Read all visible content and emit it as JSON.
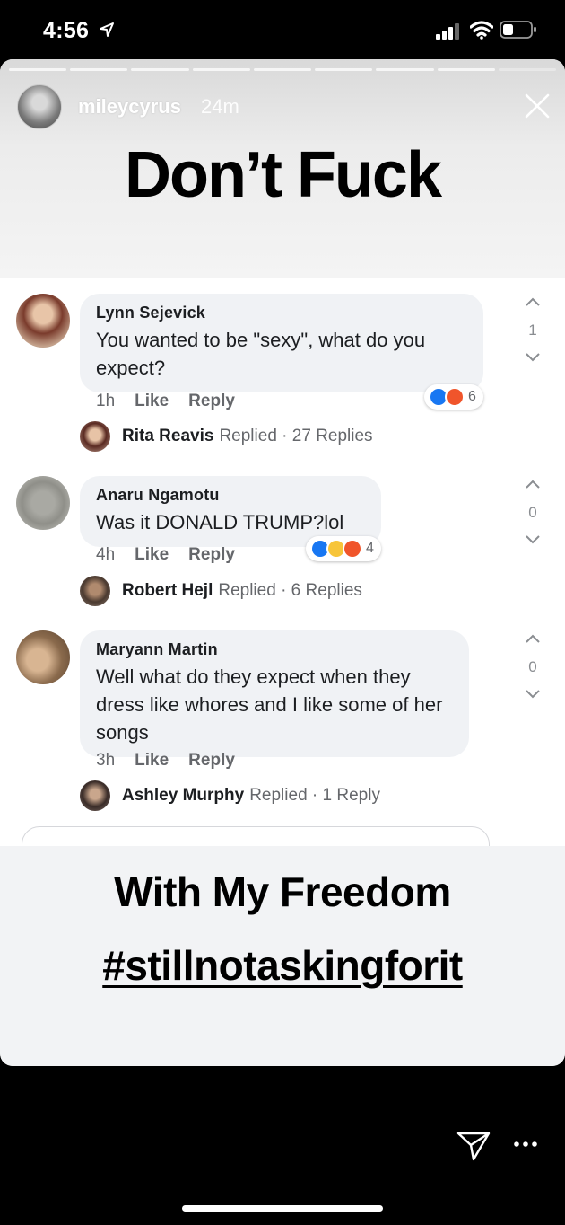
{
  "status_bar": {
    "time": "4:56"
  },
  "story": {
    "username": "mileycyrus",
    "age": "24m",
    "headline": "Don’t Fuck",
    "caption_line1": "With My Freedom",
    "caption_line2": "#stillnotaskingforit"
  },
  "comments": [
    {
      "author": "Lynn Sejevick",
      "text": "You wanted to be \"sexy\", what do you expect?",
      "time": "1h",
      "like": "Like",
      "reply": "Reply",
      "reaction_count": "6",
      "reactions": [
        "like",
        "angry"
      ],
      "votes": "1",
      "reply_name": "Rita Reavis",
      "replied": "Replied",
      "reply_count": "· 27 Replies"
    },
    {
      "author": "Anaru Ngamotu",
      "text": "Was it DONALD TRUMP?lol",
      "time": "4h",
      "like": "Like",
      "reply": "Reply",
      "reaction_count": "4",
      "reactions": [
        "like",
        "haha",
        "angry"
      ],
      "votes": "0",
      "reply_name": "Robert Hejl",
      "replied": "Replied",
      "reply_count": "· 6 Replies"
    },
    {
      "author": "Maryann Martin",
      "text": "Well what do they expect when they dress like whores and I like some of her songs",
      "time": "3h",
      "like": "Like",
      "reply": "Reply",
      "votes": "0",
      "reply_name": "Ashley Murphy",
      "replied": "Replied",
      "reply_count": "· 1 Reply"
    }
  ],
  "icons": [
    "location-arrow-icon",
    "signal-icon",
    "wifi-icon",
    "battery-icon",
    "close-icon",
    "chevron-up-icon",
    "chevron-down-icon",
    "send-icon",
    "more-icon"
  ],
  "colors": {
    "facebook_blue": "#1877f2",
    "angry": "#f0552b",
    "haha": "#f7c53a",
    "meta_gray": "#65676b"
  }
}
